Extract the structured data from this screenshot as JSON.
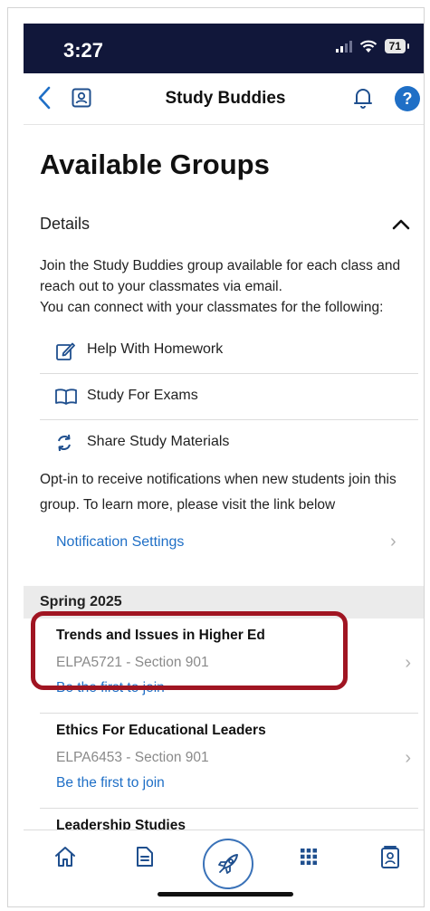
{
  "status_bar": {
    "time": "3:27",
    "battery": "71"
  },
  "nav": {
    "title": "Study Buddies",
    "help": "?"
  },
  "page": {
    "title": "Available Groups",
    "details_label": "Details",
    "intro_line1": "Join the Study Buddies group available for each class and reach out to your classmates via email.",
    "intro_line2": "You can connect with your classmates for the following:",
    "features": [
      {
        "label": "Help With Homework",
        "icon": "edit-icon"
      },
      {
        "label": "Study For Exams",
        "icon": "book-icon"
      },
      {
        "label": "Share Study Materials",
        "icon": "sync-icon"
      }
    ],
    "optin_text": "Opt-in to receive notifications when new students join this group. To learn more, please visit the link below",
    "notification_link": "Notification Settings",
    "term": "Spring 2025",
    "groups": [
      {
        "title": "Trends and Issues in Higher Ed",
        "code": "ELPA5721 - Section 901",
        "join": "Be the first to join"
      },
      {
        "title": "Ethics For Educational Leaders",
        "code": "ELPA6453 - Section 901",
        "join": "Be the first to join"
      },
      {
        "title": "Leadership Studies"
      }
    ]
  },
  "tabs": [
    {
      "icon": "home-icon"
    },
    {
      "icon": "document-icon"
    },
    {
      "icon": "rocket-icon"
    },
    {
      "icon": "grid-icon"
    },
    {
      "icon": "id-card-icon"
    }
  ],
  "colors": {
    "status_bar": "#11173a",
    "accent": "#1f6fc6",
    "highlight": "#a01522"
  }
}
